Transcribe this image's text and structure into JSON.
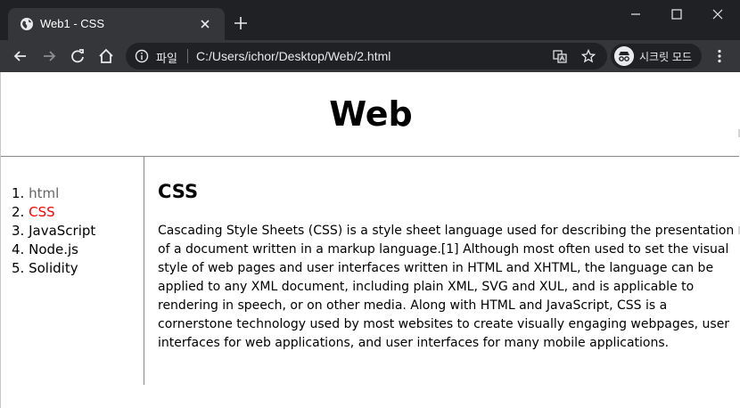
{
  "browser": {
    "tab": {
      "title": "Web1 - CSS"
    },
    "omnibox": {
      "chip_label": "파일",
      "url": "C:/Users/ichor/Desktop/Web/2.html"
    },
    "incognito_label": "시크릿 모드",
    "icons": [
      "globe-icon",
      "close-icon",
      "plus-icon",
      "minimize-icon",
      "maximize-icon",
      "back-icon",
      "forward-icon",
      "reload-icon",
      "home-icon",
      "info-icon",
      "translate-icon",
      "star-icon",
      "incognito-icon",
      "more-vert-icon"
    ]
  },
  "page": {
    "title": "Web",
    "nav": [
      {
        "num": "1.",
        "label": "html",
        "color": "#666666"
      },
      {
        "num": "2.",
        "label": "CSS",
        "color": "#ff0000"
      },
      {
        "num": "3.",
        "label": "JavaScript",
        "color": "#000000"
      },
      {
        "num": "4.",
        "label": "Node.js",
        "color": "#000000"
      },
      {
        "num": "5.",
        "label": "Solidity",
        "color": "#000000"
      }
    ],
    "heading": "CSS",
    "paragraph": "Cascading Style Sheets (CSS) is a style sheet language used for describing the presentation of a document written in a markup language.[1] Although most often used to set the visual style of web pages and user interfaces written in HTML and XHTML, the language can be applied to any XML document, including plain XML, SVG and XUL, and is applicable to rendering in speech, or on other media. Along with HTML and JavaScript, CSS is a cornerstone technology used by most websites to create visually engaging webpages, user interfaces for web applications, and user interfaces for many mobile applications."
  },
  "colors": {
    "titlebar": "#202124",
    "tab_active": "#35363a",
    "link_visited": "#666666",
    "link_active": "#ff0000"
  }
}
